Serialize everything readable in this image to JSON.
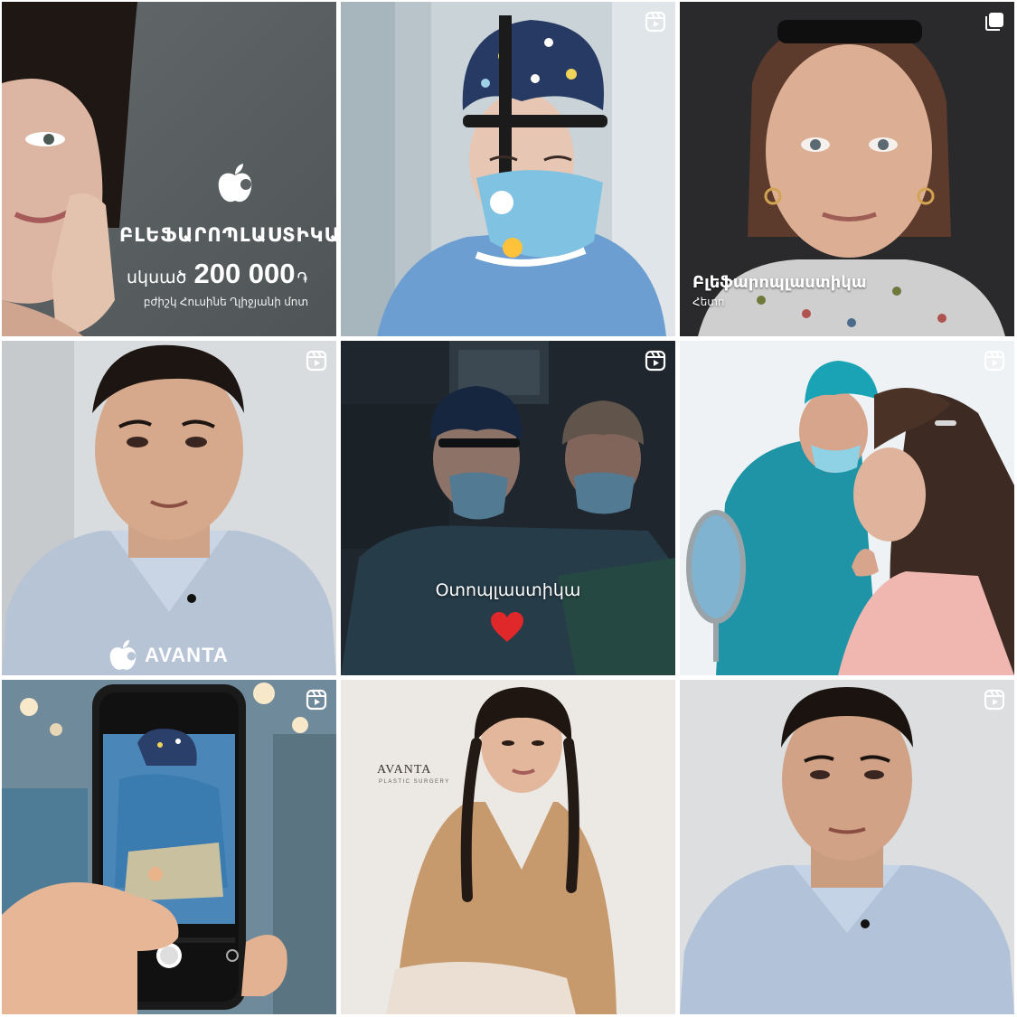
{
  "feed": {
    "posts": [
      {
        "badge": "none",
        "title": "ԲԼԵՖԱՐՈՊԼԱՍՏԻԿԱ",
        "price_prefix": "սկսած",
        "price_amount": "200 000",
        "price_currency": "֏",
        "doctor": "բժիշկ Հուսինե Ղլիջյանի մոտ",
        "logo_icon": "apple-logo-icon"
      },
      {
        "badge": "reel-icon"
      },
      {
        "badge": "carousel-icon",
        "caption": "Բլեֆարոպլաստիկա",
        "caption_sub": "Հետո"
      },
      {
        "badge": "reel-icon",
        "logo_text": "AVANTA",
        "logo_icon": "apple-logo-icon"
      },
      {
        "badge": "reel-icon",
        "caption": "Օտոպլաստիկա",
        "emoji": "heart-icon"
      },
      {
        "badge": "reel-icon"
      },
      {
        "badge": "reel-icon"
      },
      {
        "badge": "none",
        "brand": "AVANTA",
        "brand_sub": "PLASTIC SURGERY"
      },
      {
        "badge": "reel-icon"
      }
    ]
  },
  "colors": {
    "badge": "#ffffff",
    "heart": "#e0272a",
    "tile1_bg": "#5f6567"
  }
}
